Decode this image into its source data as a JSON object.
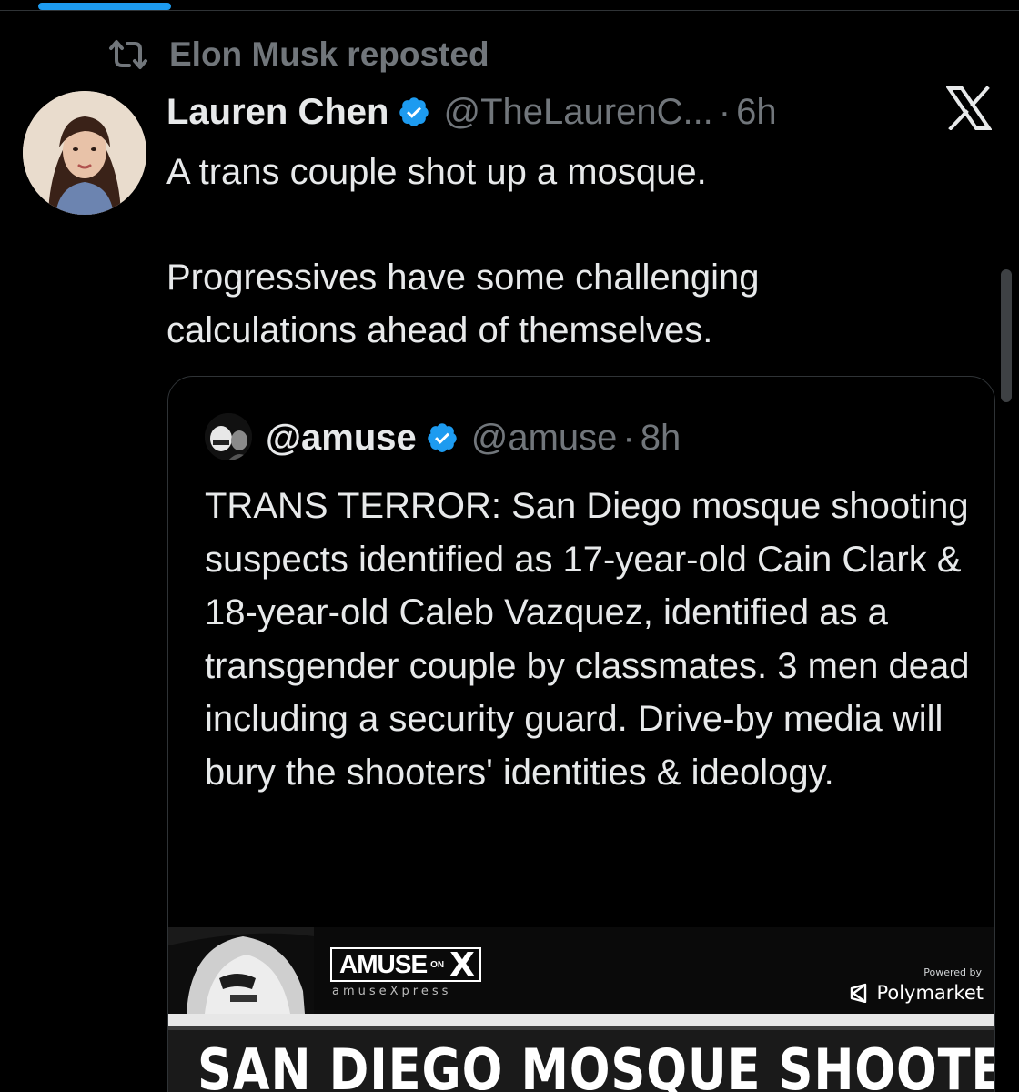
{
  "repost": {
    "label": "Elon Musk reposted"
  },
  "tweet": {
    "author": {
      "display_name": "Lauren Chen",
      "handle": "@TheLaurenC...",
      "verified": true
    },
    "separator": "·",
    "time": "6h",
    "text_lines": [
      "A trans couple shot up a mosque.",
      "Progressives have some challenging calculations ahead of themselves."
    ]
  },
  "quote": {
    "author": {
      "display_name": "@amuse",
      "handle": "@amuse",
      "verified": true
    },
    "separator": "·",
    "time": "8h",
    "text": "TRANS TERROR: San Diego mosque shooting suspects identified as 17-year-old Cain Clark & 18-year-old Caleb Vazquez, identified as a transgender couple by classmates. 3 men dead including a security guard. Drive-by media will bury the shooters' identities & ideology.",
    "media": {
      "logo_main": "AMUSE",
      "logo_on": "ON",
      "logo_x": "X",
      "logo_sub": "amuseXpress",
      "powered_by": "Powered by",
      "sponsor": "Polymarket",
      "headline": "SAN DIEGO MOSQUE SHOOTERS"
    }
  },
  "icons": {
    "repost": "repost-icon",
    "verified": "verified-badge-icon",
    "brand": "x-logo-icon",
    "polymarket": "polymarket-logo-icon"
  },
  "colors": {
    "background": "#000000",
    "text": "#e7e9ea",
    "muted": "#71767b",
    "accent": "#1d9bf0",
    "border": "#2f3336"
  }
}
